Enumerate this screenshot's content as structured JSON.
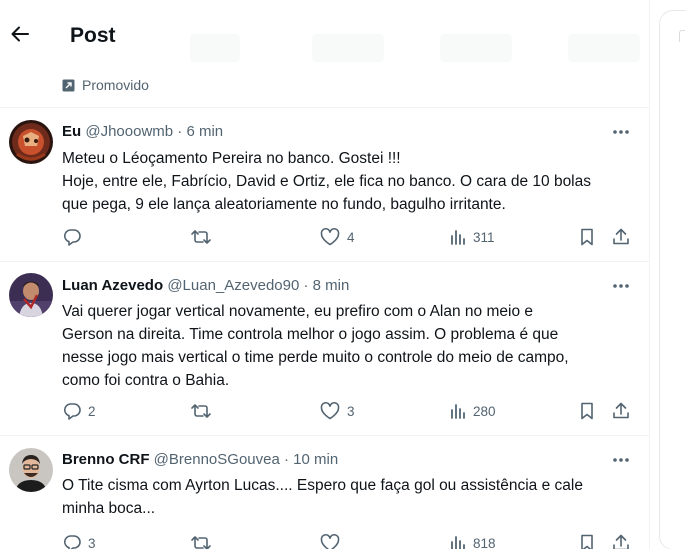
{
  "header": {
    "title": "Post",
    "back_icon": "arrow-left-icon"
  },
  "promo": {
    "label": "Promovido",
    "icon": "promoted-icon"
  },
  "tweets": [
    {
      "name": "Eu",
      "handle": "@Jhooowmb",
      "sep": "·",
      "time": "6 min",
      "lines": [
        "Meteu o Léoçamento Pereira no banco. Gostei !!!",
        "Hoje, entre ele, Fabrício, David e Ortiz, ele fica no banco. O cara de 10 bolas",
        "que pega, 9 ele lança aleatoriamente no fundo, bagulho irritante."
      ],
      "replies": "",
      "retweets": "",
      "likes": "4",
      "views": "311"
    },
    {
      "name": "Luan Azevedo",
      "handle": "@Luan_Azevedo90",
      "sep": "·",
      "time": "8 min",
      "lines": [
        "Vai querer jogar vertical novamente, eu prefiro com o Alan no meio e",
        "Gerson na direita. Time controla melhor o jogo assim. O problema é que",
        "nesse jogo mais vertical o time perde muito o controle do meio de campo,",
        "como foi contra o Bahia."
      ],
      "replies": "2",
      "retweets": "",
      "likes": "3",
      "views": "280"
    },
    {
      "name": "Brenno CRF",
      "handle": "@BrennoSGouvea",
      "sep": "·",
      "time": "10 min",
      "lines": [
        "O Tite cisma com Ayrton Lucas.... Espero que faça gol ou assistência e cale",
        "minha boca..."
      ],
      "replies": "3",
      "retweets": "",
      "likes": "",
      "views": "818"
    }
  ],
  "colors": {
    "text_primary": "#0f1419",
    "text_secondary": "#536471",
    "divider": "#eff3f4"
  },
  "icons": {
    "more": "more-dots-icon",
    "reply": "reply-icon",
    "retweet": "retweet-icon",
    "like": "heart-icon",
    "views": "views-bar-icon",
    "bookmark": "bookmark-icon",
    "share": "share-icon"
  }
}
